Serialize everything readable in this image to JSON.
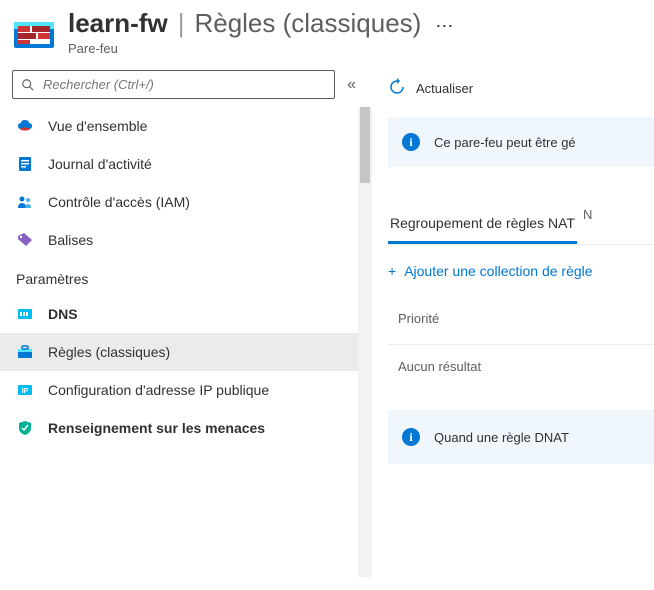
{
  "header": {
    "title": "learn-fw",
    "section": "Règles (classiques)",
    "subtitle": "Pare-feu"
  },
  "search": {
    "placeholder": "Rechercher (Ctrl+/)"
  },
  "nav": {
    "overview": "Vue d'ensemble",
    "activity": "Journal d'activité",
    "access": "Contrôle d'accès (IAM)",
    "tags": "Balises",
    "params_header": "Paramètres",
    "dns": "DNS",
    "rules": "Règles (classiques)",
    "ipconfig": "Configuration d'adresse IP publique",
    "threat": "Renseignement sur les menaces"
  },
  "toolbar": {
    "refresh": "Actualiser"
  },
  "banner1": "Ce pare-feu peut être gé",
  "tabs": {
    "nat": "Regroupement de règles NAT"
  },
  "add_link": "Ajouter une collection de règle",
  "table": {
    "col_priority": "Priorité",
    "empty": "Aucun résultat"
  },
  "banner2": "Quand une règle DNAT"
}
